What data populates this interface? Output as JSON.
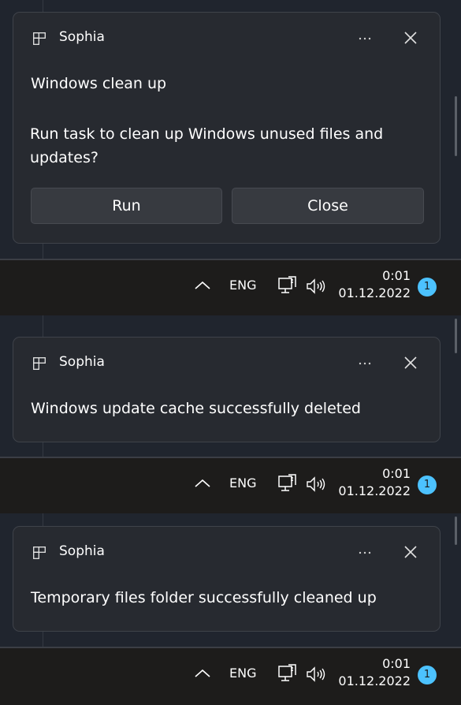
{
  "accent_color": "#4cc2ff",
  "icons": {
    "app": "app-grid-icon",
    "more": "more-options-icon",
    "close": "close-icon",
    "chevron": "chevron-up-icon",
    "network": "network-icon",
    "volume": "volume-icon"
  },
  "notifications": [
    {
      "app_name": "Sophia",
      "title": "Windows clean up",
      "message": "Run task to clean up Windows unused files and updates?",
      "buttons": {
        "run": "Run",
        "close": "Close"
      }
    },
    {
      "app_name": "Sophia",
      "message": "Windows update cache successfully deleted"
    },
    {
      "app_name": "Sophia",
      "message": "Temporary files folder successfully cleaned up"
    }
  ],
  "taskbar": {
    "language": "ENG",
    "time": "0:01",
    "date": "01.12.2022",
    "notification_count": "1"
  }
}
